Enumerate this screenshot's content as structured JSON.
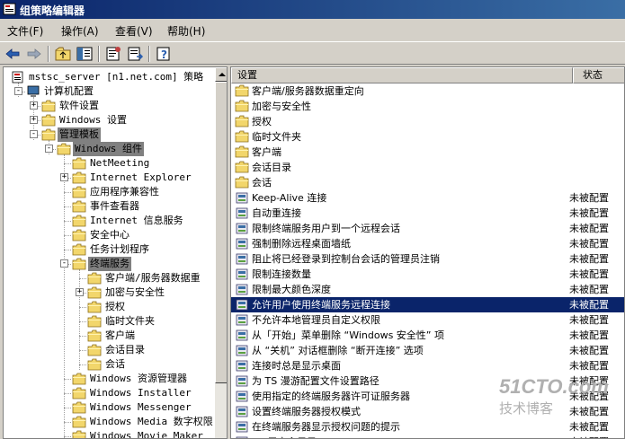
{
  "window": {
    "title": "组策略编辑器"
  },
  "menu": [
    "文件(F)",
    "操作(A)",
    "查看(V)",
    "帮助(H)"
  ],
  "toolbar": [
    "back-icon",
    "forward-icon",
    "up-folder-icon",
    "show-tree-icon",
    "properties-icon",
    "export-list-icon",
    "help-icon"
  ],
  "tree": [
    {
      "label": "mstsc_server [n1.net.com] 策略",
      "icon": "policy-icon",
      "indent": 0
    },
    {
      "label": "计算机配置",
      "icon": "computer-icon",
      "indent": 1,
      "exp": "-"
    },
    {
      "label": "软件设置",
      "icon": "folder-icon",
      "indent": 2,
      "exp": "+"
    },
    {
      "label": "Windows 设置",
      "icon": "folder-icon",
      "indent": 2,
      "exp": "+"
    },
    {
      "label": "管理模板",
      "icon": "folder-icon",
      "indent": 2,
      "exp": "-",
      "sel": true
    },
    {
      "label": "Windows 组件",
      "icon": "folder-icon",
      "indent": 3,
      "exp": "-",
      "sel": true
    },
    {
      "label": "NetMeeting",
      "icon": "folder-icon",
      "indent": 4
    },
    {
      "label": "Internet Explorer",
      "icon": "folder-icon",
      "indent": 4,
      "exp": "+"
    },
    {
      "label": "应用程序兼容性",
      "icon": "folder-icon",
      "indent": 4
    },
    {
      "label": "事件查看器",
      "icon": "folder-icon",
      "indent": 4
    },
    {
      "label": "Internet 信息服务",
      "icon": "folder-icon",
      "indent": 4
    },
    {
      "label": "安全中心",
      "icon": "folder-icon",
      "indent": 4
    },
    {
      "label": "任务计划程序",
      "icon": "folder-icon",
      "indent": 4
    },
    {
      "label": "终端服务",
      "icon": "folder-icon",
      "indent": 4,
      "exp": "-",
      "sel": true
    },
    {
      "label": "客户端/服务器数据重",
      "icon": "folder-icon",
      "indent": 5
    },
    {
      "label": "加密与安全性",
      "icon": "folder-icon",
      "indent": 5,
      "exp": "+"
    },
    {
      "label": "授权",
      "icon": "folder-icon",
      "indent": 5
    },
    {
      "label": "临时文件夹",
      "icon": "folder-icon",
      "indent": 5
    },
    {
      "label": "客户端",
      "icon": "folder-icon",
      "indent": 5
    },
    {
      "label": "会话目录",
      "icon": "folder-icon",
      "indent": 5
    },
    {
      "label": "会话",
      "icon": "folder-icon",
      "indent": 5
    },
    {
      "label": "Windows 资源管理器",
      "icon": "folder-icon",
      "indent": 4
    },
    {
      "label": "Windows Installer",
      "icon": "folder-icon",
      "indent": 4
    },
    {
      "label": "Windows Messenger",
      "icon": "folder-icon",
      "indent": 4
    },
    {
      "label": "Windows Media 数字权限",
      "icon": "folder-icon",
      "indent": 4
    },
    {
      "label": "Windows Movie Maker",
      "icon": "folder-icon",
      "indent": 4
    }
  ],
  "list": {
    "headers": {
      "setting": "设置",
      "state": "状态"
    },
    "rows": [
      {
        "name": "客户端/服务器数据重定向",
        "state": "",
        "icon": "folder-icon"
      },
      {
        "name": "加密与安全性",
        "state": "",
        "icon": "folder-icon"
      },
      {
        "name": "授权",
        "state": "",
        "icon": "folder-icon"
      },
      {
        "name": "临时文件夹",
        "state": "",
        "icon": "folder-icon"
      },
      {
        "name": "客户端",
        "state": "",
        "icon": "folder-icon"
      },
      {
        "name": "会话目录",
        "state": "",
        "icon": "folder-icon"
      },
      {
        "name": "会话",
        "state": "",
        "icon": "folder-icon"
      },
      {
        "name": "Keep-Alive 连接",
        "state": "未被配置",
        "icon": "policy-setting-icon"
      },
      {
        "name": "自动重连接",
        "state": "未被配置",
        "icon": "policy-setting-icon"
      },
      {
        "name": "限制终端服务用户到一个远程会话",
        "state": "未被配置",
        "icon": "policy-setting-icon"
      },
      {
        "name": "强制删除远程桌面墙纸",
        "state": "未被配置",
        "icon": "policy-setting-icon"
      },
      {
        "name": "阻止将已经登录到控制台会话的管理员注销",
        "state": "未被配置",
        "icon": "policy-setting-icon"
      },
      {
        "name": "限制连接数量",
        "state": "未被配置",
        "icon": "policy-setting-icon"
      },
      {
        "name": "限制最大颜色深度",
        "state": "未被配置",
        "icon": "policy-setting-icon"
      },
      {
        "name": "允许用户使用终端服务远程连接",
        "state": "未被配置",
        "icon": "policy-setting-icon",
        "sel": true
      },
      {
        "name": "不允许本地管理员自定义权限",
        "state": "未被配置",
        "icon": "policy-setting-icon"
      },
      {
        "name": "从「开始」菜单删除 “Windows 安全性” 项",
        "state": "未被配置",
        "icon": "policy-setting-icon"
      },
      {
        "name": "从 “关机” 对话框删除 “断开连接” 选项",
        "state": "未被配置",
        "icon": "policy-setting-icon"
      },
      {
        "name": "连接时总是显示桌面",
        "state": "未被配置",
        "icon": "policy-setting-icon"
      },
      {
        "name": "为 TS 漫游配置文件设置路径",
        "state": "未被配置",
        "icon": "policy-setting-icon"
      },
      {
        "name": "使用指定的终端服务器许可证服务器",
        "state": "未被配置",
        "icon": "policy-setting-icon"
      },
      {
        "name": "设置终端服务器授权模式",
        "state": "未被配置",
        "icon": "policy-setting-icon"
      },
      {
        "name": "在终端服务器显示授权问题的提示",
        "state": "未被配置",
        "icon": "policy-setting-icon"
      },
      {
        "name": "TS 用户主目录",
        "state": "未被配置",
        "icon": "policy-setting-icon"
      }
    ]
  },
  "watermark": {
    "line1": "51CTO.com",
    "line2": "技术博客"
  },
  "colors": {
    "title_bar": "#0a246a",
    "selection": "#0a246a",
    "tree_selection": "#808080",
    "folder": "#f2d66b"
  }
}
